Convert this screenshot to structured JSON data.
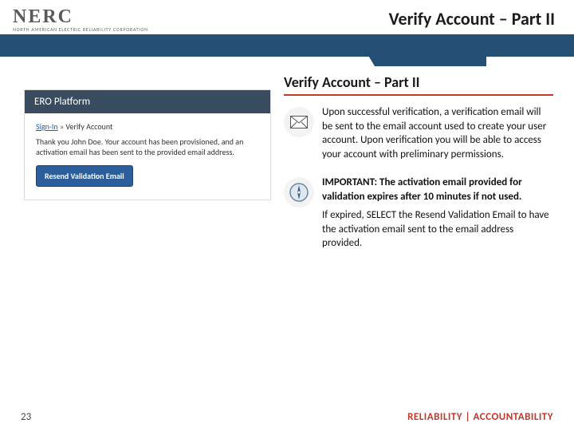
{
  "logo": {
    "name": "NERC",
    "subtitle": "NORTH AMERICAN ELECTRIC RELIABILITY CORPORATION"
  },
  "header": {
    "title": "Verify Account – Part II"
  },
  "screenshot": {
    "platform_title": "ERO Platform",
    "breadcrumb": {
      "root": "Sign-In",
      "sep": "»",
      "current": "Verify Account"
    },
    "body": "Thank you John Doe. Your account has been provisioned, and an activation email has been sent to the provided email address.",
    "button": "Resend Validation Email"
  },
  "right": {
    "heading": "Verify Account – Part II",
    "para1": "Upon successful verification, a verification email will be sent to the email account used to create your user account. Upon verification you will be able to access your account with preliminary permissions.",
    "important_label": "IMPORTANT:",
    "important_rest": " The activation email provided for validation expires after 10 minutes if not used.",
    "para3": "If expired, SELECT the Resend Validation Email to have the activation email sent to the email address provided."
  },
  "footer": {
    "page": "23",
    "tagline": "RELIABILITY | ACCOUNTABILITY"
  }
}
